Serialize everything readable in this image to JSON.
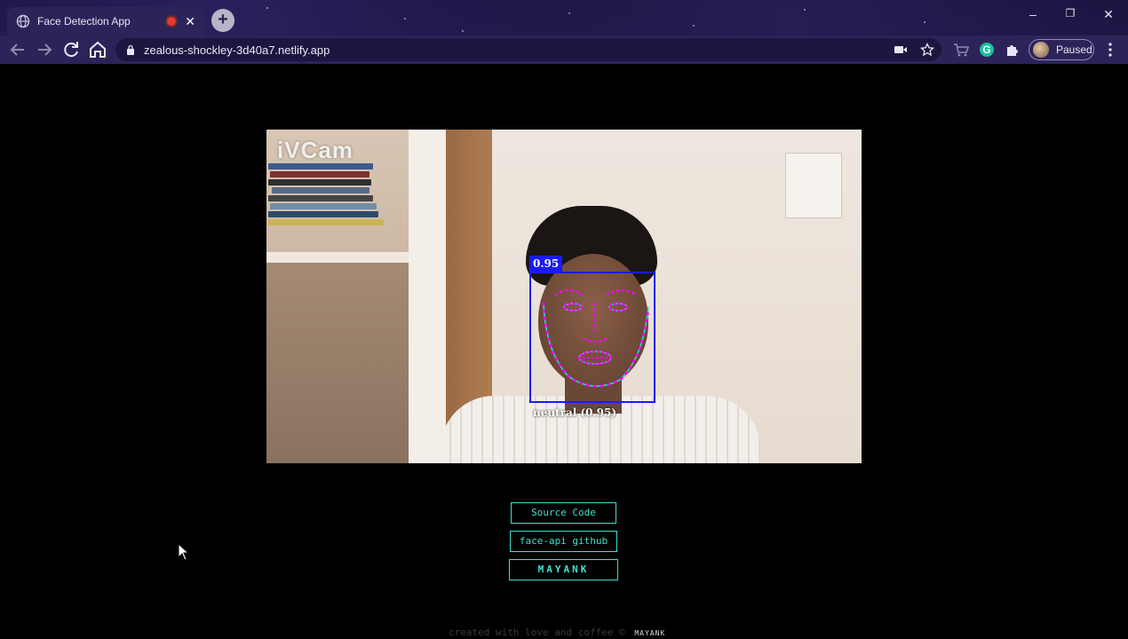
{
  "browser": {
    "tab_title": "Face Detection App",
    "new_tab_symbol": "+",
    "url": "zealous-shockley-3d40a7.netlify.app",
    "profile_status": "Paused",
    "window_controls": [
      "–",
      "❐",
      "✕"
    ],
    "icons": [
      "back-icon",
      "forward-icon",
      "reload-icon",
      "home-icon",
      "lock-icon",
      "camera-icon",
      "star-icon",
      "cart-icon",
      "grammarly-icon",
      "extensions-icon",
      "menu-icon"
    ]
  },
  "video": {
    "watermark": "iVCam",
    "detection_score": "0.95",
    "expression_label": "neutral (0.95)"
  },
  "buttons": {
    "source_code": "Source Code",
    "github": "face-api github",
    "mayank": "MAYANK"
  },
  "footer": {
    "text": "created with love and coffee ©",
    "logo_text": "MAYANK"
  },
  "colors": {
    "accent": "#40e0d0",
    "detection_box": "#1a1aff",
    "landmarks": "#ff00ff",
    "browser_frame": "#2c2459"
  }
}
